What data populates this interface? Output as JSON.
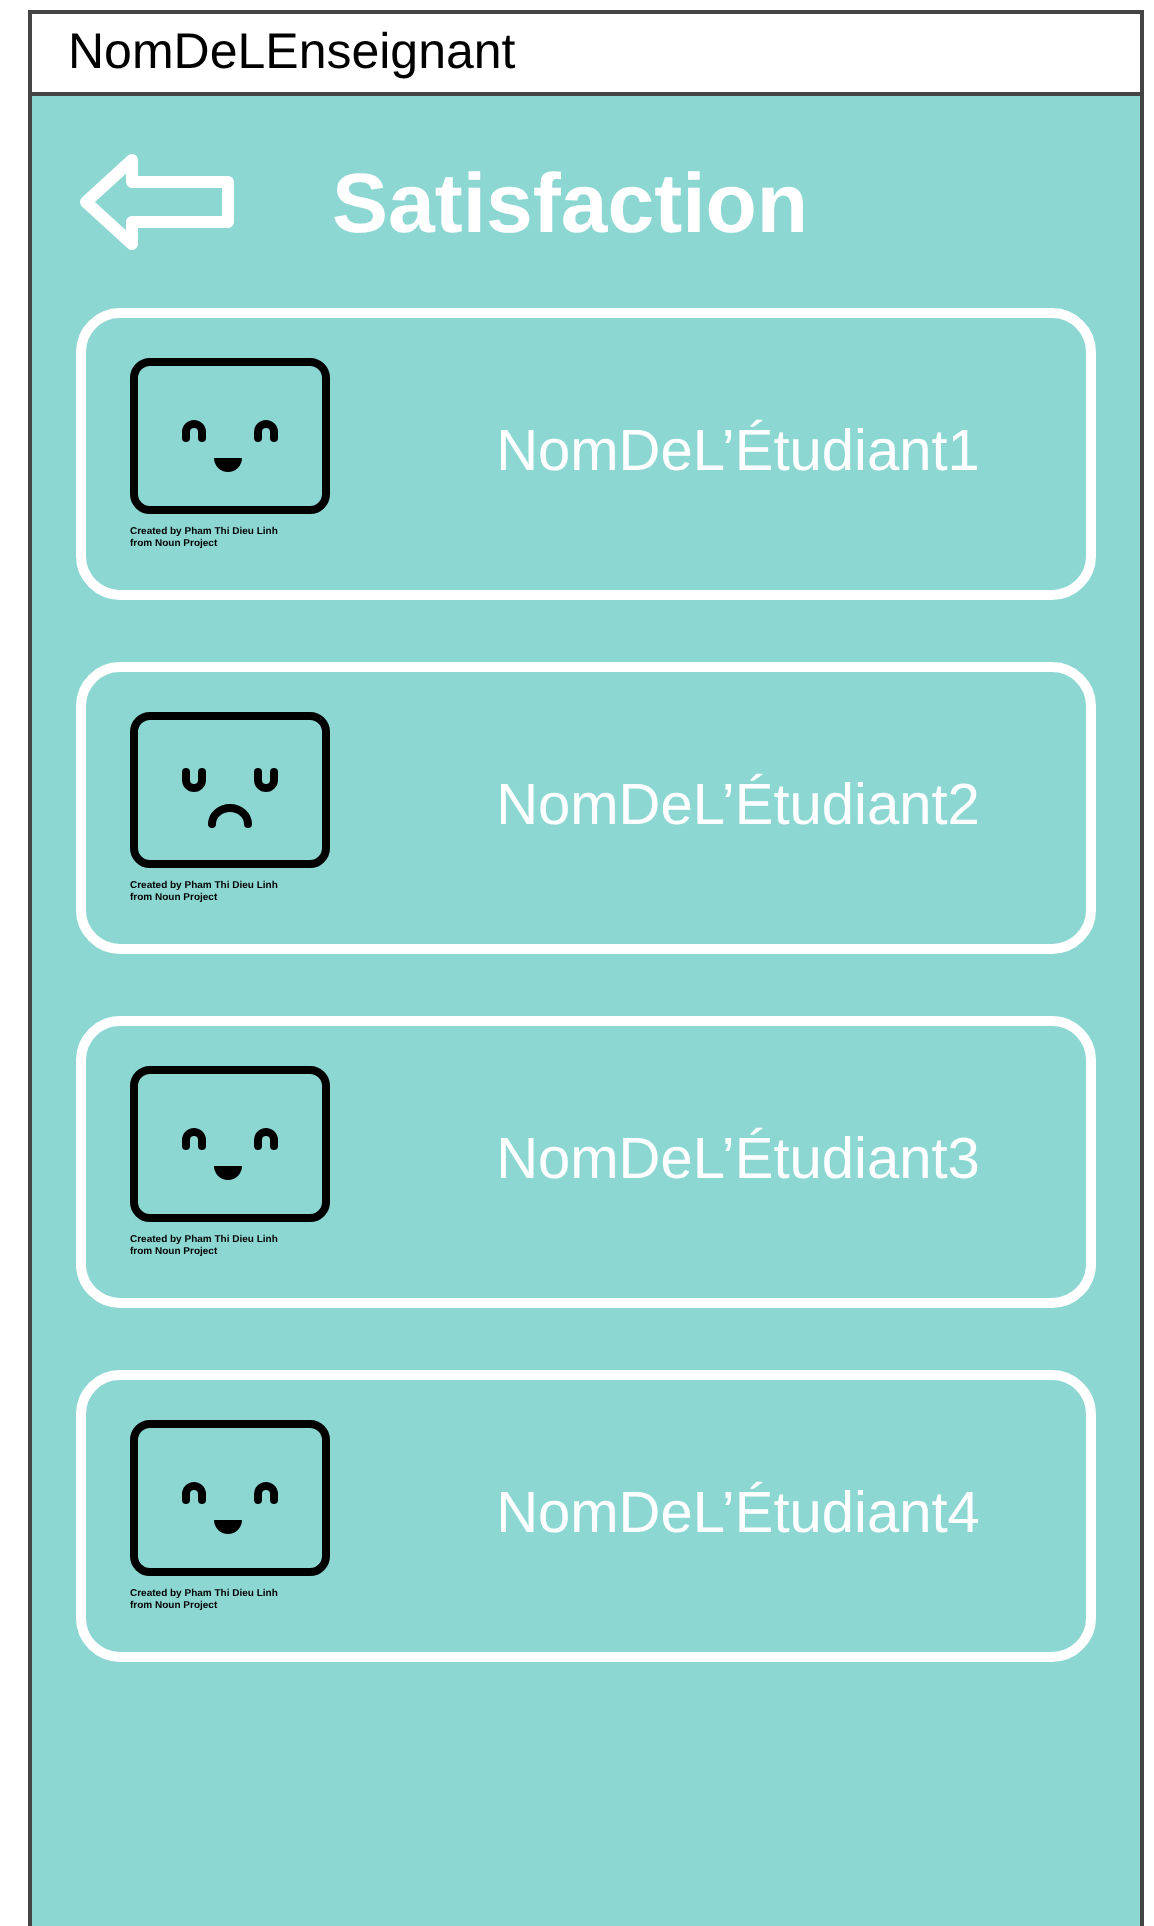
{
  "window": {
    "title": "NomDeLEnseignant"
  },
  "header": {
    "title": "Satisfaction"
  },
  "students": [
    {
      "name": "NomDeL’Étudiant1",
      "kind": "happy",
      "credit": [
        "Created by Pham Thi Dieu Linh",
        "from Noun Project"
      ]
    },
    {
      "name": "NomDeL’Étudiant2",
      "kind": "sad",
      "credit": [
        "Created by Pham Thi Dieu Linh",
        "from Noun Project"
      ]
    },
    {
      "name": "NomDeL’Étudiant3",
      "kind": "happy",
      "credit": [
        "Created by Pham Thi Dieu Linh",
        "from Noun Project"
      ]
    },
    {
      "name": "NomDeL’Étudiant4",
      "kind": "happy",
      "credit": [
        "Created by Pham Thi Dieu Linh",
        "from Noun Project"
      ]
    }
  ]
}
